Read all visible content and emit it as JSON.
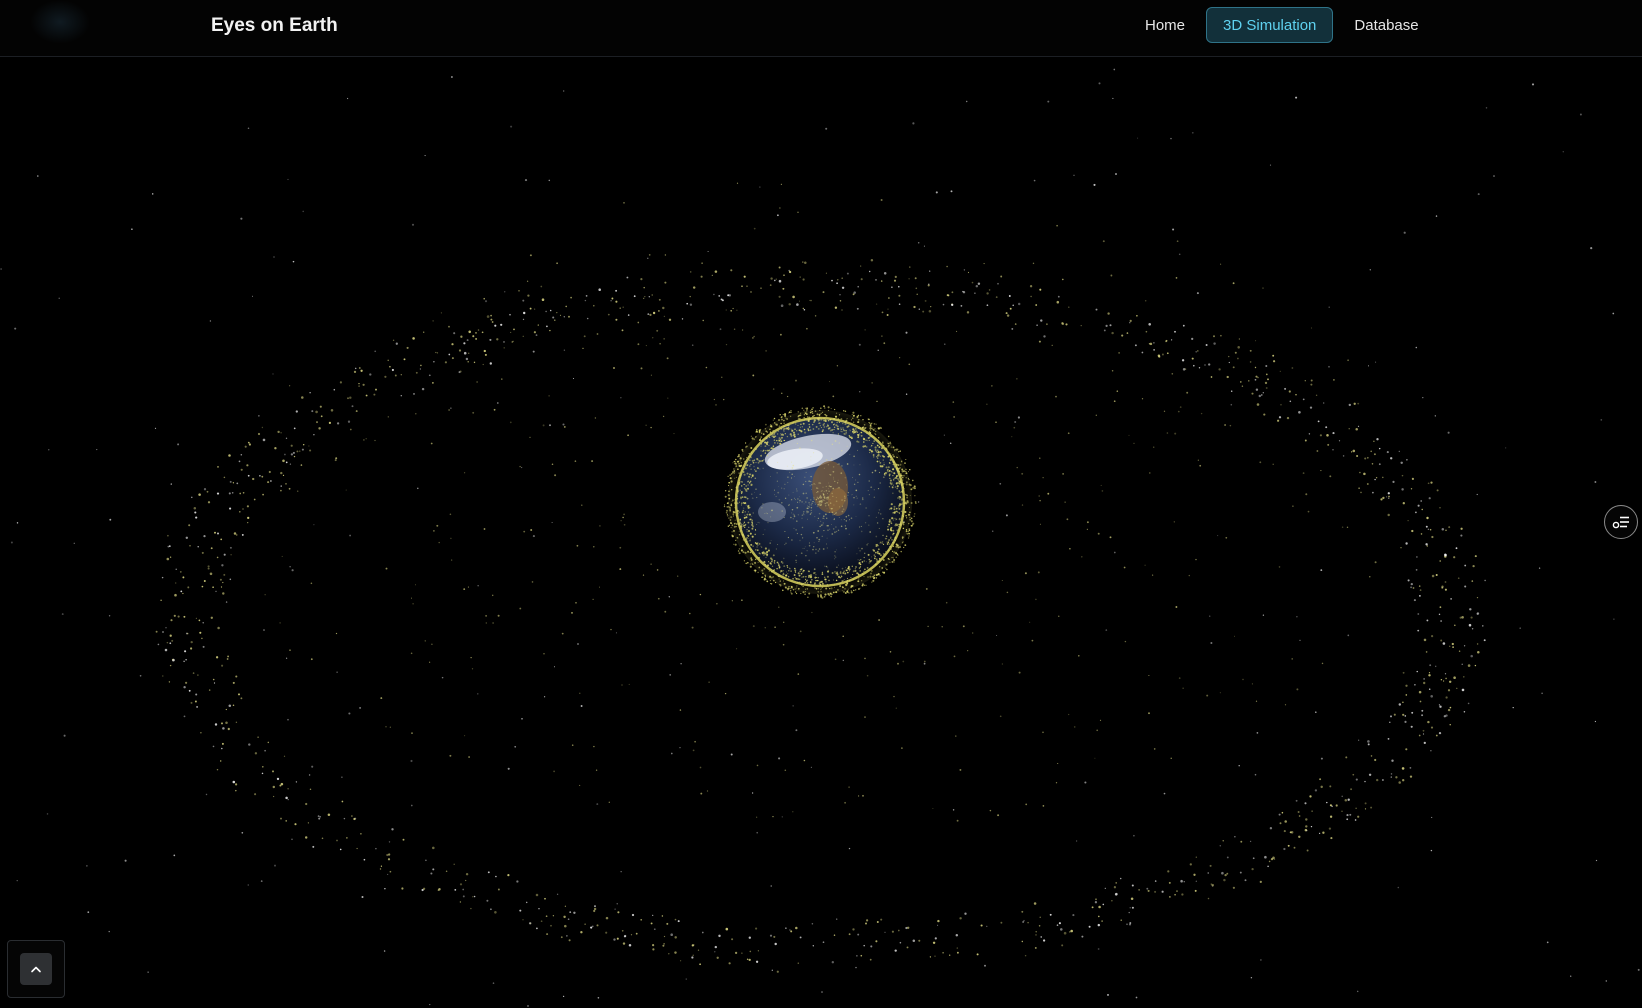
{
  "header": {
    "brand": "Eyes on Earth",
    "nav": [
      {
        "label": "Home",
        "active": false
      },
      {
        "label": "3D Simulation",
        "active": true
      },
      {
        "label": "Database",
        "active": false
      }
    ]
  },
  "scene": {
    "description_icon": "globe-with-orbiting-debris",
    "debris_color": "#e8e38a",
    "ring_color": "#d9d46a",
    "accent_color": "#5fd2f0"
  },
  "controls": {
    "side_panel_icon": "settings-list-icon",
    "scroll_top_icon": "chevron-up-icon"
  }
}
